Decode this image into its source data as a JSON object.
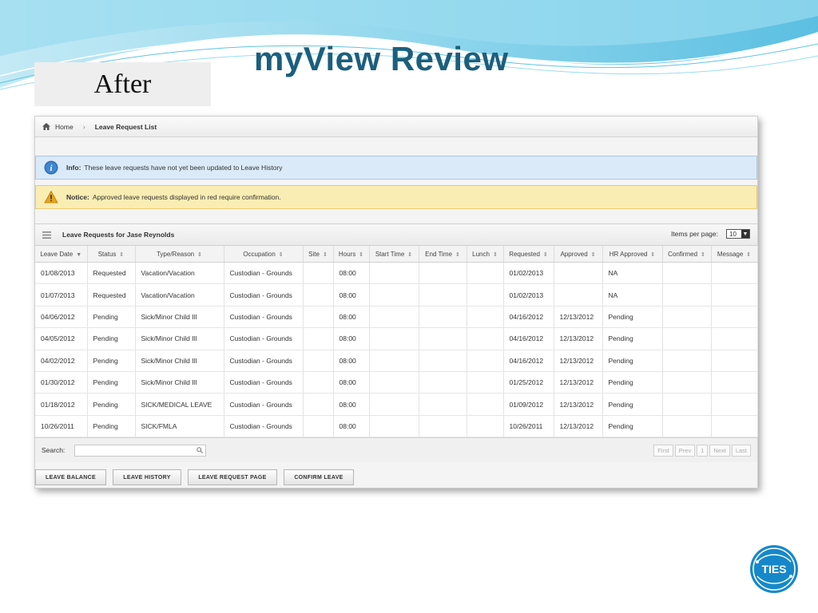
{
  "slide": {
    "title": "myView Review",
    "tag": "After",
    "logo_text": "TIES",
    "accent_color": "#1b5f7d"
  },
  "breadcrumb": {
    "home": "Home",
    "separator": "›",
    "current": "Leave Request List",
    "icon": "home-icon"
  },
  "alerts": {
    "info_label": "Info:",
    "info_text": "These leave requests have not yet been updated to Leave History",
    "notice_label": "Notice:",
    "notice_text": "Approved leave requests displayed in red require confirmation."
  },
  "table": {
    "title": "Leave Requests for Jase Reynolds",
    "items_per_page_label": "Items per page:",
    "items_per_page_value": "10",
    "columns": [
      "Leave Date",
      "Status",
      "Type/Reason",
      "Occupation",
      "Site",
      "Hours",
      "Start Time",
      "End Time",
      "Lunch",
      "Requested",
      "Approved",
      "HR Approved",
      "Confirmed",
      "Message"
    ],
    "rows": [
      [
        "01/08/2013",
        "Requested",
        "Vacation/Vacation",
        "Custodian - Grounds",
        "",
        "08:00",
        "",
        "",
        "",
        "01/02/2013",
        "",
        "NA",
        "",
        ""
      ],
      [
        "01/07/2013",
        "Requested",
        "Vacation/Vacation",
        "Custodian - Grounds",
        "",
        "08:00",
        "",
        "",
        "",
        "01/02/2013",
        "",
        "NA",
        "",
        ""
      ],
      [
        "04/06/2012",
        "Pending",
        "Sick/Minor Child Ill",
        "Custodian - Grounds",
        "",
        "08:00",
        "",
        "",
        "",
        "04/16/2012",
        "12/13/2012",
        "Pending",
        "",
        ""
      ],
      [
        "04/05/2012",
        "Pending",
        "Sick/Minor Child Ill",
        "Custodian - Grounds",
        "",
        "08:00",
        "",
        "",
        "",
        "04/16/2012",
        "12/13/2012",
        "Pending",
        "",
        ""
      ],
      [
        "04/02/2012",
        "Pending",
        "Sick/Minor Child Ill",
        "Custodian - Grounds",
        "",
        "08:00",
        "",
        "",
        "",
        "04/16/2012",
        "12/13/2012",
        "Pending",
        "",
        ""
      ],
      [
        "01/30/2012",
        "Pending",
        "Sick/Minor Child Ill",
        "Custodian - Grounds",
        "",
        "08:00",
        "",
        "",
        "",
        "01/25/2012",
        "12/13/2012",
        "Pending",
        "",
        ""
      ],
      [
        "01/18/2012",
        "Pending",
        "SICK/MEDICAL LEAVE",
        "Custodian - Grounds",
        "",
        "08:00",
        "",
        "",
        "",
        "01/09/2012",
        "12/13/2012",
        "Pending",
        "",
        ""
      ],
      [
        "10/26/2011",
        "Pending",
        "SICK/FMLA",
        "Custodian - Grounds",
        "",
        "08:00",
        "",
        "",
        "",
        "10/26/2011",
        "12/13/2012",
        "Pending",
        "",
        ""
      ]
    ]
  },
  "footer": {
    "search_label": "Search:",
    "search_value": "",
    "pager": [
      "First",
      "Prev",
      "1",
      "Next",
      "Last"
    ]
  },
  "actions": [
    "LEAVE BALANCE",
    "LEAVE HISTORY",
    "LEAVE REQUEST PAGE",
    "CONFIRM LEAVE"
  ]
}
